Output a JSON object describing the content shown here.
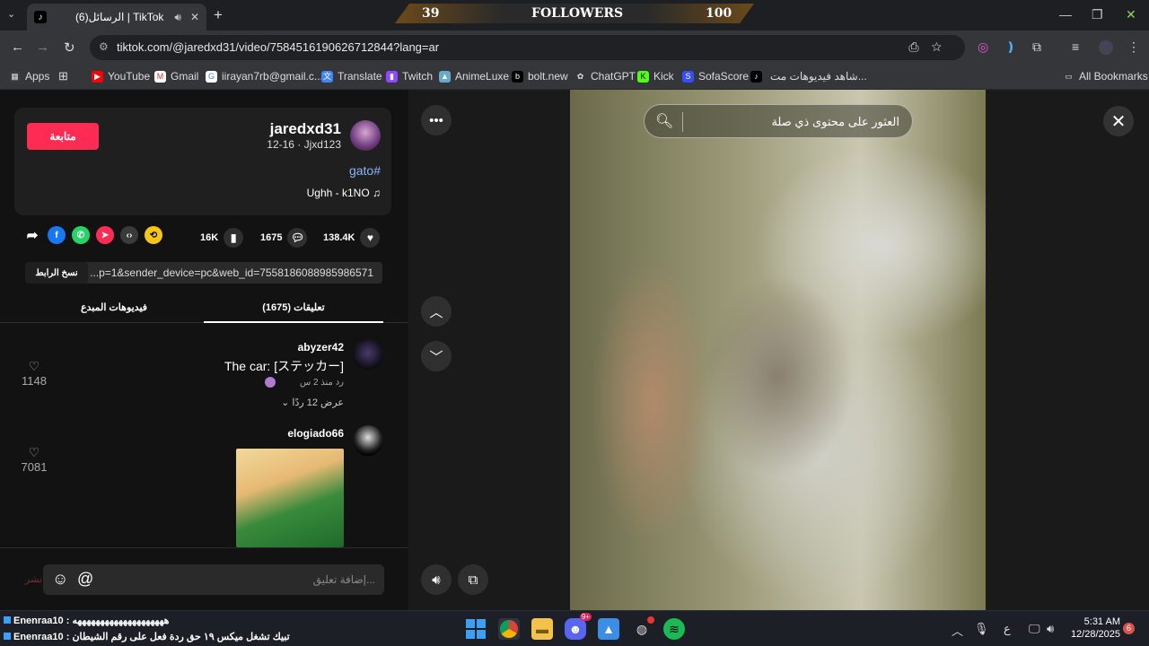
{
  "browser": {
    "tab_title": "(6)الرسائل | TikTok",
    "url": "tiktok.com/@jaredxd31/video/7584516190626712844?lang=ar",
    "followers_overlay": {
      "left_value": "39",
      "label": "FOLLOWERS",
      "right_value": "100"
    },
    "bookmarks": [
      {
        "label": "Apps",
        "icon": "apps-grid-icon"
      },
      {
        "label": "YouTube",
        "icon": "youtube-icon"
      },
      {
        "label": "Gmail",
        "icon": "gmail-icon"
      },
      {
        "label": "iirayan7rb@gmail.c...",
        "icon": "google-icon"
      },
      {
        "label": "Translate",
        "icon": "translate-icon"
      },
      {
        "label": "Twitch",
        "icon": "twitch-icon"
      },
      {
        "label": "AnimeLuxe",
        "icon": "animeluxe-icon"
      },
      {
        "label": "bolt.new",
        "icon": "bolt-icon"
      },
      {
        "label": "ChatGPT",
        "icon": "chatgpt-icon"
      },
      {
        "label": "Kick",
        "icon": "kick-icon"
      },
      {
        "label": "SofaScore",
        "icon": "sofascore-icon"
      },
      {
        "label": "شاهد فيديوهات مت...",
        "icon": "tiktok-icon"
      }
    ],
    "all_bookmarks": "All Bookmarks"
  },
  "creator": {
    "username": "jaredxd31",
    "nickname_line": "12-16 · Jjxd123",
    "follow_label": "متابعة",
    "hashtag": "gato#",
    "music": "Ughh - k1NO ♫"
  },
  "stats": {
    "likes": "138.4K",
    "comments": "1675",
    "saves": "16K"
  },
  "share": {
    "copy_link_label": "نسخ الرابط",
    "link_text": "...p=1&sender_device=pc&web_id=7558186088985986571"
  },
  "tabs": {
    "comments": "(1675) تعليقات",
    "creator_videos": "فيديوهات المبدع"
  },
  "comments": [
    {
      "user": "abyzer42",
      "text": "The car: [ステッカー]",
      "time": "منذ 2 س",
      "reply": "رد",
      "view_replies": "عرض 12 ردًا",
      "likes": "1148"
    },
    {
      "user": "elogiado66",
      "likes": "7081"
    }
  ],
  "comment_input": {
    "placeholder": "إضافة تعليق...",
    "post": "نشر"
  },
  "video_search": {
    "placeholder": "العثور على محتوى ذي صلة"
  },
  "taskbar": {
    "chat_lines": [
      {
        "name": "Enenraa10",
        "text": " : ههههههههههههههههههههه"
      },
      {
        "name": "Enenraa10",
        "text": " : تبيك تشغل ميكس ١٩ حق ردة فعل على رقم الشيطان"
      }
    ],
    "lang": "ع",
    "time": "5:31 AM",
    "date": "12/28/2025",
    "notifications": "6",
    "discord_badge": "9+"
  },
  "colors": {
    "accent": "#fe2c55",
    "link": "#8ab4f8",
    "panel": "#121212"
  }
}
